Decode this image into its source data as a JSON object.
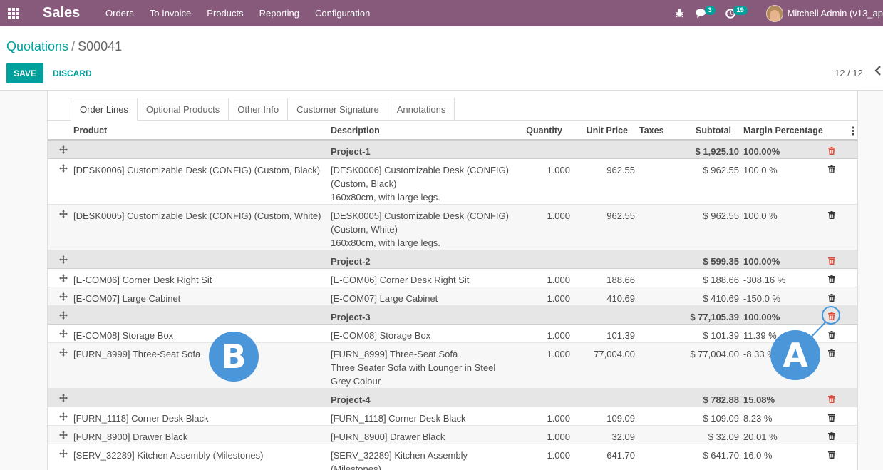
{
  "navbar": {
    "app_name": "Sales",
    "menu": [
      "Orders",
      "To Invoice",
      "Products",
      "Reporting",
      "Configuration"
    ],
    "chat_count": "3",
    "activity_count": "19",
    "user": "Mitchell Admin (v13_ap"
  },
  "control_panel": {
    "breadcrumb_parent": "Quotations",
    "breadcrumb_sep": "/",
    "breadcrumb_current": "S00041",
    "save_label": "SAVE",
    "discard_label": "DISCARD",
    "pager": "12 / 12"
  },
  "tabs": [
    "Order Lines",
    "Optional Products",
    "Other Info",
    "Customer Signature",
    "Annotations"
  ],
  "columns": {
    "product": "Product",
    "description": "Description",
    "quantity": "Quantity",
    "unit_price": "Unit Price",
    "taxes": "Taxes",
    "subtotal": "Subtotal",
    "margin": "Margin Percentage"
  },
  "rows": [
    {
      "type": "section",
      "name": "Project-1",
      "subtotal": "$ 1,925.10",
      "margin": "100.00%"
    },
    {
      "type": "line",
      "product": "[DESK0006] Customizable Desk (CONFIG) (Custom, Black)",
      "description": [
        "[DESK0006] Customizable Desk (CONFIG)",
        "(Custom, Black)",
        "160x80cm, with large legs."
      ],
      "quantity": "1.000",
      "unit_price": "962.55",
      "subtotal": "$ 962.55",
      "margin": "100.0 %"
    },
    {
      "type": "line",
      "product": "[DESK0005] Customizable Desk (CONFIG) (Custom, White)",
      "description": [
        "[DESK0005] Customizable Desk (CONFIG)",
        "(Custom, White)",
        "160x80cm, with large legs."
      ],
      "quantity": "1.000",
      "unit_price": "962.55",
      "subtotal": "$ 962.55",
      "margin": "100.0 %"
    },
    {
      "type": "section",
      "name": "Project-2",
      "subtotal": "$ 599.35",
      "margin": "100.00%"
    },
    {
      "type": "line",
      "product": "[E-COM06] Corner Desk Right Sit",
      "description": [
        "[E-COM06] Corner Desk Right Sit"
      ],
      "quantity": "1.000",
      "unit_price": "188.66",
      "subtotal": "$ 188.66",
      "margin": "-308.16 %"
    },
    {
      "type": "line",
      "product": "[E-COM07] Large Cabinet",
      "description": [
        "[E-COM07] Large Cabinet"
      ],
      "quantity": "1.000",
      "unit_price": "410.69",
      "subtotal": "$ 410.69",
      "margin": "-150.0 %"
    },
    {
      "type": "section",
      "name": "Project-3",
      "subtotal": "$ 77,105.39",
      "margin": "100.00%"
    },
    {
      "type": "line",
      "product": "[E-COM08] Storage Box",
      "description": [
        "[E-COM08] Storage Box"
      ],
      "quantity": "1.000",
      "unit_price": "101.39",
      "subtotal": "$ 101.39",
      "margin": "11.39 %"
    },
    {
      "type": "line",
      "product": "[FURN_8999] Three-Seat Sofa",
      "description": [
        "[FURN_8999] Three-Seat Sofa",
        "Three Seater Sofa with Lounger in Steel",
        "Grey Colour"
      ],
      "quantity": "1.000",
      "unit_price": "77,004.00",
      "subtotal": "$ 77,004.00",
      "margin": "-8.33 %"
    },
    {
      "type": "section",
      "name": "Project-4",
      "subtotal": "$ 782.88",
      "margin": "15.08%"
    },
    {
      "type": "line",
      "product": "[FURN_1118] Corner Desk Black",
      "description": [
        "[FURN_1118] Corner Desk Black"
      ],
      "quantity": "1.000",
      "unit_price": "109.09",
      "subtotal": "$ 109.09",
      "margin": "8.23 %"
    },
    {
      "type": "line",
      "product": "[FURN_8900] Drawer Black",
      "description": [
        "[FURN_8900] Drawer Black"
      ],
      "quantity": "1.000",
      "unit_price": "32.09",
      "subtotal": "$ 32.09",
      "margin": "20.01 %"
    },
    {
      "type": "line",
      "product": "[SERV_32289] Kitchen Assembly (Milestones)",
      "description": [
        "[SERV_32289] Kitchen Assembly",
        "(Milestones)"
      ],
      "quantity": "1.000",
      "unit_price": "641.70",
      "subtotal": "$ 641.70",
      "margin": "16.0 %"
    }
  ],
  "callouts": {
    "a": "A",
    "b": "B"
  },
  "colors": {
    "navbar": "#875a7b",
    "accent": "#00a09d",
    "danger": "#dd4b39",
    "callout": "#4a96d8"
  },
  "icons": [
    "apps-grid-icon",
    "bug-icon",
    "chat-icon",
    "clock-icon",
    "move-handle-icon",
    "trash-icon",
    "kebab-menu-icon",
    "chevron-left-icon"
  ]
}
